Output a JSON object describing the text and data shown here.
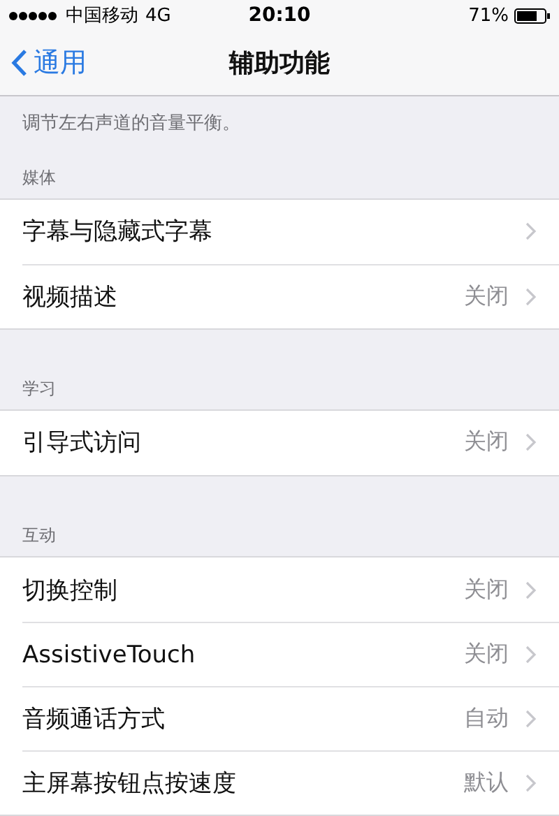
{
  "status_bar": {
    "carrier": "中国移动",
    "network": "4G",
    "time": "20:10",
    "battery": "71%"
  },
  "nav_bar": {
    "back": "通用",
    "title": "辅助功能"
  },
  "footer_note": "调节左右声道的音量平衡。",
  "sections": [
    {
      "header": "媒体",
      "rows": [
        {
          "label": "字幕与隐藏式字幕"
        },
        {
          "label": "视频描述",
          "value": "关闭"
        }
      ]
    },
    {
      "header": "学习",
      "rows": [
        {
          "label": "引导式访问",
          "value": "关闭"
        }
      ]
    },
    {
      "header": "互动",
      "rows": [
        {
          "label": "切换控制",
          "value": "关闭"
        },
        {
          "label": "AssistiveTouch",
          "value": "关闭"
        },
        {
          "label": "音频通话方式",
          "value": "自动"
        },
        {
          "label": "主屏幕按钮点按速度",
          "value": "默认"
        }
      ]
    }
  ]
}
